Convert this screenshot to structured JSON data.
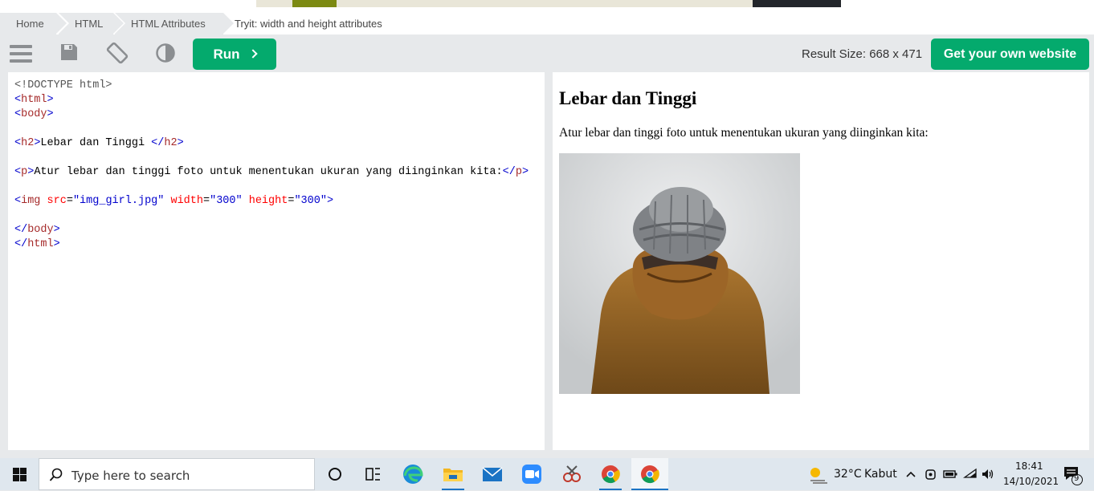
{
  "breadcrumb": {
    "items": [
      "Home",
      "HTML",
      "HTML Attributes"
    ],
    "current": "Tryit: width and height attributes"
  },
  "toolbar": {
    "run_label": "Run",
    "result_size": "Result Size: 668 x 471",
    "get_website_label": "Get your own website",
    "icons": [
      "menu-icon",
      "save-icon",
      "rotate-icon",
      "contrast-icon"
    ]
  },
  "code": {
    "doctype": "<!DOCTYPE html>",
    "h2_text": "Lebar dan Tinggi ",
    "p_text": "Atur lebar dan tinggi foto untuk menentukan ukuran yang diinginkan kita:",
    "img_src": "\"img_girl.jpg\"",
    "img_width": "\"300\"",
    "img_height": "\"300\""
  },
  "result": {
    "heading": "Lebar dan Tinggi",
    "paragraph": "Atur lebar dan tinggi foto untuk menentukan ukuran yang diinginkan kita:"
  },
  "taskbar": {
    "search_placeholder": "Type here to search",
    "weather_temp": "32°C",
    "weather_desc": "Kabut",
    "time": "18:41",
    "date": "14/10/2021",
    "notification_count": "9"
  },
  "colors": {
    "accent": "#04aa6d",
    "toolbar_bg": "#e7e9eb"
  }
}
